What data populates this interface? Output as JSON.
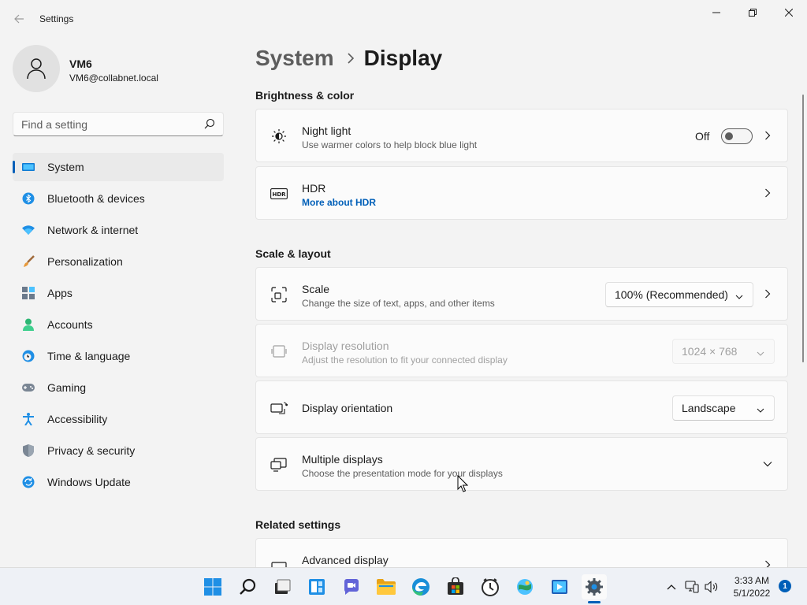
{
  "window": {
    "title": "Settings",
    "back_label": "←"
  },
  "colors": {
    "accent": "#005fb8",
    "background": "#f3f3f3",
    "card": "#fbfbfb"
  },
  "user": {
    "name": "VM6",
    "email": "VM6@collabnet.local"
  },
  "search": {
    "placeholder": "Find a setting"
  },
  "sidebar": {
    "items": [
      {
        "label": "System",
        "icon": "monitor-icon",
        "active": true
      },
      {
        "label": "Bluetooth & devices",
        "icon": "bluetooth-icon"
      },
      {
        "label": "Network & internet",
        "icon": "wifi-icon"
      },
      {
        "label": "Personalization",
        "icon": "paintbrush-icon"
      },
      {
        "label": "Apps",
        "icon": "apps-icon"
      },
      {
        "label": "Accounts",
        "icon": "person-icon"
      },
      {
        "label": "Time & language",
        "icon": "globe-clock-icon"
      },
      {
        "label": "Gaming",
        "icon": "gamepad-icon"
      },
      {
        "label": "Accessibility",
        "icon": "accessibility-icon"
      },
      {
        "label": "Privacy & security",
        "icon": "shield-icon"
      },
      {
        "label": "Windows Update",
        "icon": "update-icon"
      }
    ]
  },
  "breadcrumb": {
    "parent": "System",
    "separator": "›",
    "current": "Display"
  },
  "sections": {
    "brightness": "Brightness & color",
    "scale_layout": "Scale & layout",
    "related": "Related settings"
  },
  "cards": {
    "night_light": {
      "title": "Night light",
      "subtitle": "Use warmer colors to help block blue light",
      "toggle_label": "Off",
      "toggle_on": false
    },
    "hdr": {
      "title": "HDR",
      "link": "More about HDR"
    },
    "scale": {
      "title": "Scale",
      "subtitle": "Change the size of text, apps, and other items",
      "value": "100% (Recommended)"
    },
    "resolution": {
      "title": "Display resolution",
      "subtitle": "Adjust the resolution to fit your connected display",
      "value": "1024 × 768",
      "disabled": true
    },
    "orientation": {
      "title": "Display orientation",
      "value": "Landscape"
    },
    "multiple": {
      "title": "Multiple displays",
      "subtitle": "Choose the presentation mode for your displays"
    },
    "advanced": {
      "title": "Advanced display"
    }
  },
  "taskbar": {
    "apps": [
      "start-icon",
      "search-icon",
      "task-view-icon",
      "widgets-icon",
      "chat-icon",
      "file-explorer-icon",
      "edge-icon",
      "store-icon",
      "clock-app-icon",
      "photos-icon",
      "media-player-icon",
      "settings-icon"
    ],
    "time": "3:33 AM",
    "date": "5/1/2022",
    "notification_count": "1"
  }
}
